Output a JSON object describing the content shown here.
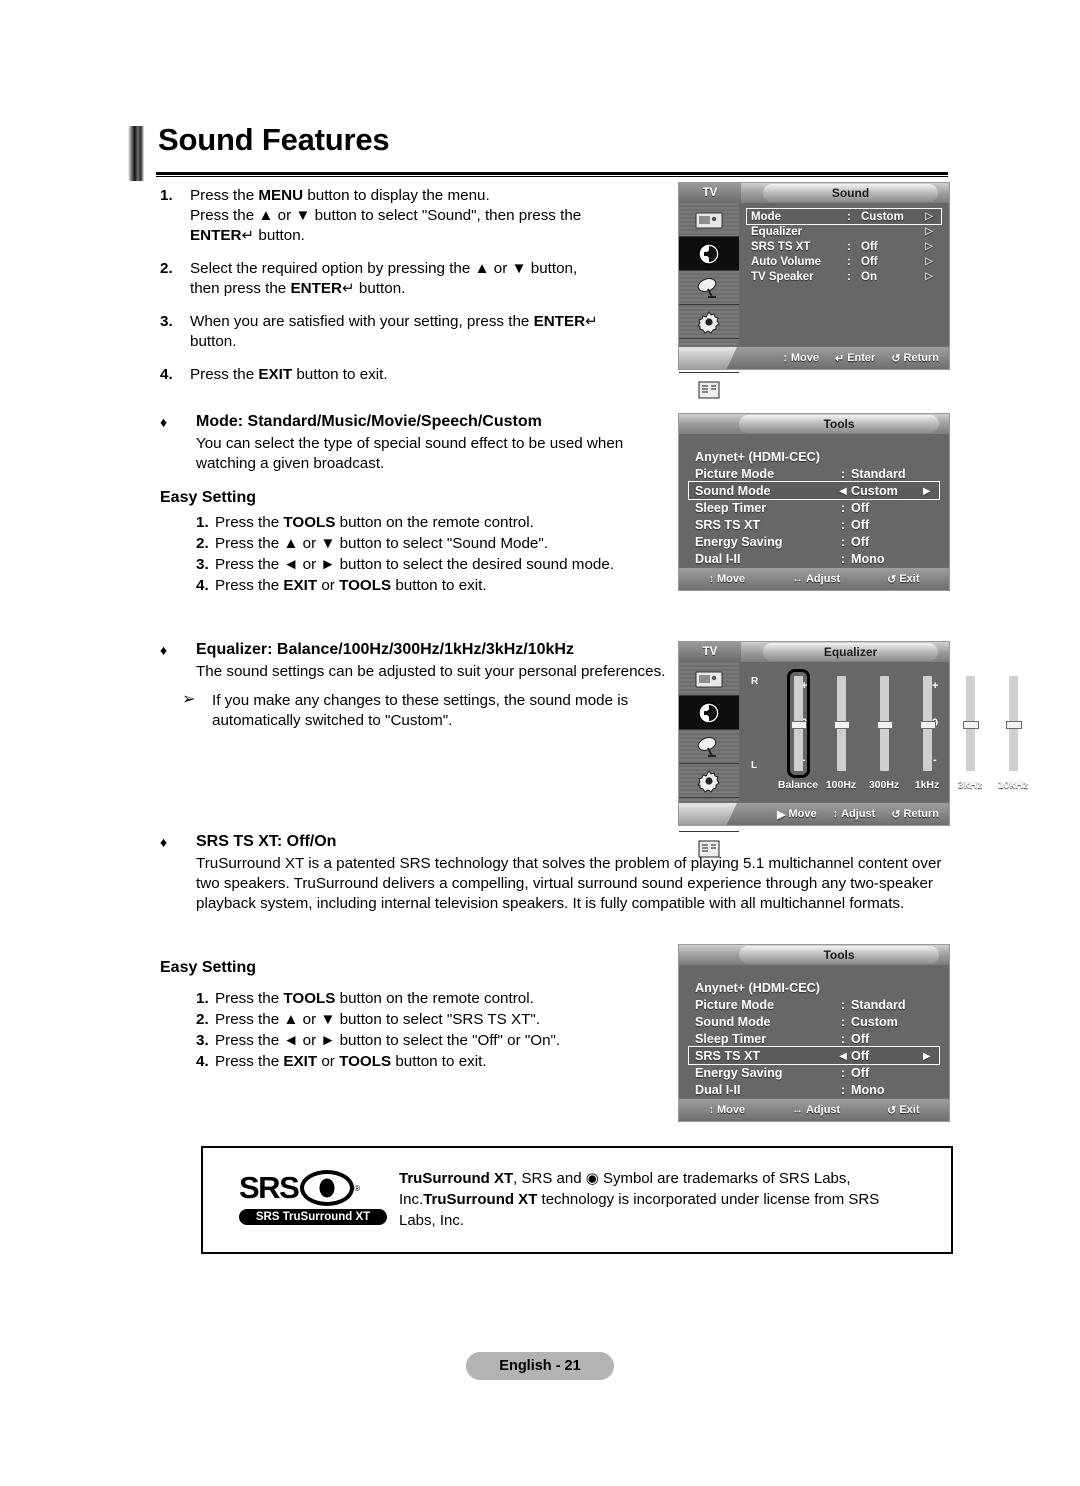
{
  "title": "Sound Features",
  "steps": [
    {
      "n": "1.",
      "html": "Press the <b>MENU</b> button to display the menu.<br>Press the ▲ or ▼ button to select \"Sound\", then press the<br><b>ENTER</b>↵ button."
    },
    {
      "n": "2.",
      "html": "Select the required option by pressing the ▲ or ▼ button,<br>then press the <b>ENTER</b>↵ button."
    },
    {
      "n": "3.",
      "html": "When you are satisfied with your setting, press the <b>ENTER</b>↵<br>button."
    },
    {
      "n": "4.",
      "html": "Press the <b>EXIT</b> button to exit."
    }
  ],
  "sections": {
    "mode": {
      "bullet": "♦",
      "title": "Mode: Standard/Music/Movie/Speech/Custom",
      "body": "You can select the type of special sound effect to be used when watching a given broadcast.",
      "easy_setting_label": "Easy Setting",
      "easy_steps": [
        {
          "n": "1.",
          "html": "Press the <b>TOOLS</b> button on the remote control."
        },
        {
          "n": "2.",
          "html": "Press the ▲ or ▼ button to select \"Sound Mode\"."
        },
        {
          "n": "3.",
          "html": "Press the ◄ or ► button to select the desired sound mode."
        },
        {
          "n": "4.",
          "html": "Press the <b>EXIT</b> or <b>TOOLS</b> button to exit."
        }
      ]
    },
    "equalizer": {
      "bullet": "♦",
      "title": "Equalizer: Balance/100Hz/300Hz/1kHz/3kHz/10kHz",
      "body": "The sound settings can be adjusted to suit your personal preferences.",
      "note_mark": "➢",
      "note": "If you make any changes to these settings, the sound mode is automatically switched to \"Custom\"."
    },
    "srs": {
      "bullet": "♦",
      "title": "SRS  TS XT: Off/On",
      "body": "TruSurround XT is a patented SRS technology that solves the problem of playing 5.1 multichannel content over two speakers. TruSurround delivers a compelling, virtual surround sound experience through any two-speaker playback system, including internal television speakers. It is fully compatible with all multichannel formats.",
      "easy_setting_label": "Easy Setting",
      "easy_steps": [
        {
          "n": "1.",
          "html": "Press the <b>TOOLS</b> button on the remote control."
        },
        {
          "n": "2.",
          "html": "Press the ▲ or ▼ button to select \"SRS TS XT\"."
        },
        {
          "n": "3.",
          "html": "Press the ◄ or ► button to select the \"Off\" or \"On\"."
        },
        {
          "n": "4.",
          "html": "Press the <b>EXIT</b> or <b>TOOLS</b> button to exit."
        }
      ]
    }
  },
  "osd": {
    "sound_menu": {
      "tv_label": "TV",
      "title": "Sound",
      "rows": [
        {
          "label": "Mode",
          "colon": ":",
          "value": "Custom",
          "arrow": "▷",
          "selected": true
        },
        {
          "label": "Equalizer",
          "colon": "",
          "value": "",
          "arrow": "▷",
          "selected": false
        },
        {
          "label": "SRS TS XT",
          "colon": ":",
          "value": "Off",
          "arrow": "▷",
          "selected": false
        },
        {
          "label": "Auto Volume",
          "colon": ":",
          "value": "Off",
          "arrow": "▷",
          "selected": false
        },
        {
          "label": "TV Speaker",
          "colon": ":",
          "value": "On",
          "arrow": "▷",
          "selected": false
        }
      ],
      "bottom": [
        {
          "icon": "↕",
          "label": "Move"
        },
        {
          "icon": "↵",
          "label": "Enter"
        },
        {
          "icon": "↺",
          "label": "Return"
        }
      ]
    },
    "tools_sound_mode": {
      "title": "Tools",
      "rows": [
        {
          "label": "Anynet+ (HDMI-CEC)",
          "sep": "",
          "value": "",
          "selected": false
        },
        {
          "label": "Picture Mode",
          "sep": ":",
          "value": "Standard",
          "selected": false
        },
        {
          "label": "Sound Mode",
          "sep": "◄",
          "value": "Custom",
          "selected": true
        },
        {
          "label": "Sleep Timer",
          "sep": ":",
          "value": "Off",
          "selected": false
        },
        {
          "label": "SRS TS XT",
          "sep": ":",
          "value": "Off",
          "selected": false
        },
        {
          "label": "Energy Saving",
          "sep": ":",
          "value": "Off",
          "selected": false
        },
        {
          "label": "Dual I-II",
          "sep": ":",
          "value": "Mono",
          "selected": false
        }
      ],
      "bottom": [
        {
          "icon": "↕",
          "label": "Move"
        },
        {
          "icon": "↔",
          "label": "Adjust"
        },
        {
          "icon": "↺",
          "label": "Exit"
        }
      ]
    },
    "equalizer_menu": {
      "tv_label": "TV",
      "title": "Equalizer",
      "r_label": "R",
      "l_label": "L",
      "plus": "+",
      "zero": "0",
      "minus": "-",
      "sliders": [
        {
          "label": "Balance",
          "value": 0,
          "selected": true
        },
        {
          "label": "100Hz",
          "value": 0,
          "selected": false
        },
        {
          "label": "300Hz",
          "value": 0,
          "selected": false
        },
        {
          "label": "1kHz",
          "value": 0,
          "selected": false
        },
        {
          "label": "3kHz",
          "value": 0,
          "selected": false
        },
        {
          "label": "10kHz",
          "value": 0,
          "selected": false
        }
      ],
      "bottom": [
        {
          "icon": "▶",
          "label": "Move"
        },
        {
          "icon": "↕",
          "label": "Adjust"
        },
        {
          "icon": "↺",
          "label": "Return"
        }
      ]
    },
    "tools_srs": {
      "title": "Tools",
      "rows": [
        {
          "label": "Anynet+ (HDMI-CEC)",
          "sep": "",
          "value": "",
          "selected": false
        },
        {
          "label": "Picture Mode",
          "sep": ":",
          "value": "Standard",
          "selected": false
        },
        {
          "label": "Sound Mode",
          "sep": ":",
          "value": "Custom",
          "selected": false
        },
        {
          "label": "Sleep Timer",
          "sep": ":",
          "value": "Off",
          "selected": false
        },
        {
          "label": "SRS TS XT",
          "sep": "◄",
          "value": "Off",
          "selected": true
        },
        {
          "label": "Energy Saving",
          "sep": ":",
          "value": "Off",
          "selected": false
        },
        {
          "label": "Dual I-II",
          "sep": ":",
          "value": "Mono",
          "selected": false
        }
      ],
      "bottom": [
        {
          "icon": "↕",
          "label": "Move"
        },
        {
          "icon": "↔",
          "label": "Adjust"
        },
        {
          "icon": "↺",
          "label": "Exit"
        }
      ]
    },
    "sidebar_icons": [
      "picture-icon",
      "sound-icon",
      "channel-dish-icon",
      "setup-gear-icon",
      "input-plug-icon",
      "support-list-icon"
    ]
  },
  "srs_box": {
    "logo_word": "SRS",
    "logo_tm": "®",
    "logo_pill": "SRS TruSurround XT",
    "text_html": "<b>TruSurround XT</b>, SRS and ◉ Symbol are trademarks of SRS Labs, Inc.<b>TruSurround XT</b> technology is incorporated under license from SRS Labs, Inc."
  },
  "footer": "English - 21",
  "colors": {
    "osd_bg": "#676767",
    "osd_border": "#9a9a9a",
    "footer_bg": "#b3b3b3",
    "text": "#000000"
  }
}
